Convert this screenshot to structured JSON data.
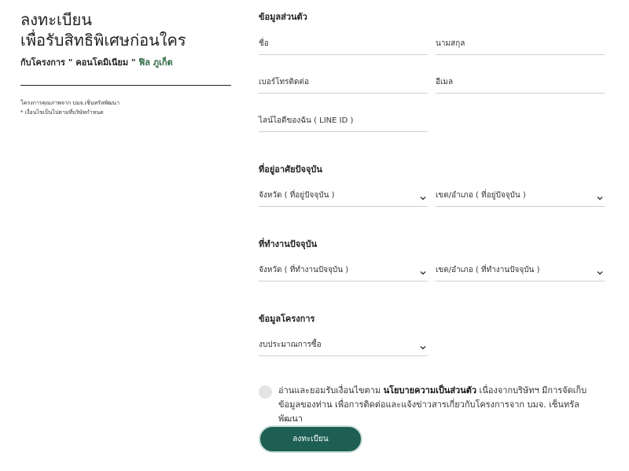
{
  "left": {
    "title_line1": "ลงทะเบียน",
    "title_line2": "เพื่อรับสิทธิพิเศษก่อนใคร",
    "project_prefix": "กับโครงการ \" คอนโดมิเนียม \" ",
    "project_brand": "ฟิล ภูเก็ต",
    "note_line1": "โครงการคุณภาพจาก บมจ.เซ็นทรัลพัฒนา",
    "note_line2": "* เงื่อนไขเป็นไปตามที่บริษัทกำหนด"
  },
  "sections": {
    "personal": "ข้อมูลส่วนตัว",
    "residence": "ที่อยู่อาศัยปัจจุบัน",
    "workplace": "ที่ทำงานปัจจุบัน",
    "project": "ข้อมูลโครงการ"
  },
  "fields": {
    "first_name": "ชื่อ",
    "last_name": "นามสกุล",
    "phone": "เบอร์โทรติดต่อ",
    "email": "อีเมล",
    "line_id": "ไลน์ไอดีของฉัน ( LINE ID )",
    "home_province": "จังหวัด ( ที่อยู่ปัจจุบัน )",
    "home_district": "เขต/อำเภอ ( ที่อยู่ปัจจุบัน )",
    "work_province": "จังหวัด ( ที่ทำงานปัจจุบัน )",
    "work_district": "เขต/อำเภอ ( ที่ทำงานปัจจุบัน )",
    "budget": "งบประมาณการซื้อ"
  },
  "consent": {
    "part1": "อ่านและยอมรับเงื่อนไขตาม ",
    "policy_link": "นโยบายความเป็นส่วนตัว",
    "part2": " เนื่องจากบริษัทฯ มีการจัดเก็บข้อมูลของท่าน เพื่อการติดต่อและแจ้งข่าวสารเกี่ยวกับโครงการจาก บมจ. เซ็นทรัลพัฒนา"
  },
  "submit_label": "ลงทะเบียน",
  "colors": {
    "brand_green": "#2f6b45",
    "button_bg": "#1d5f54"
  }
}
